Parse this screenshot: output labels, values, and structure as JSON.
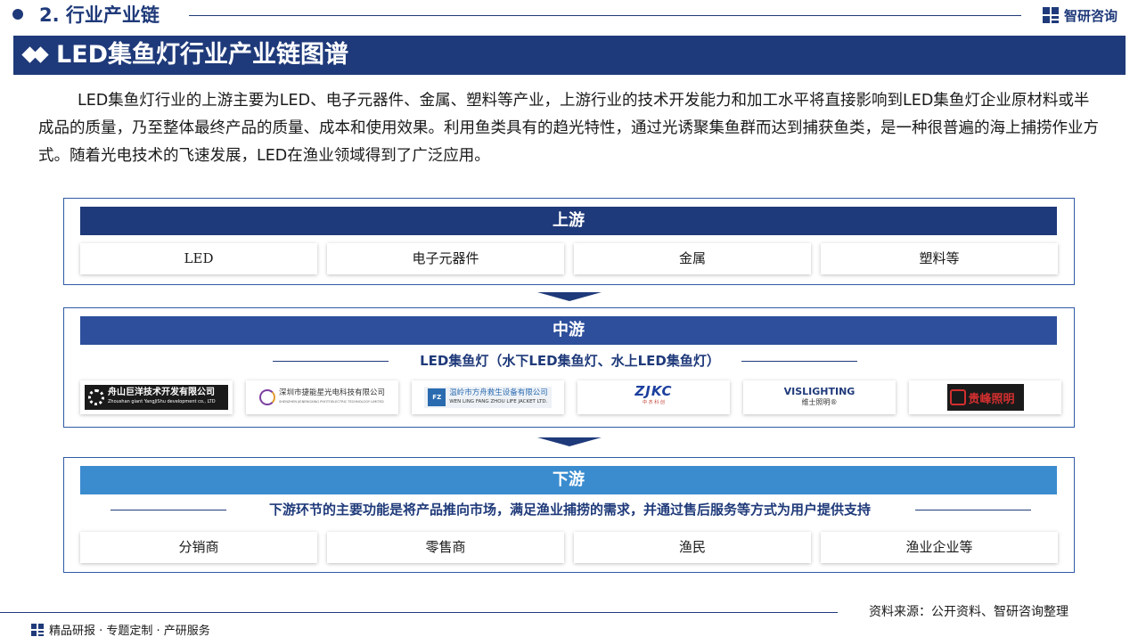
{
  "header": {
    "section_title": "2. 行业产业链",
    "brand": "智研咨询"
  },
  "banner": {
    "title": "LED集鱼灯行业产业链图谱"
  },
  "intro": "LED集鱼灯行业的上游主要为LED、电子元器件、金属、塑料等产业，上游行业的技术开发能力和加工水平将直接影响到LED集鱼灯企业原材料或半成品的质量，乃至整体最终产品的质量、成本和使用效果。利用鱼类具有的趋光特性，通过光诱聚集鱼群而达到捕获鱼类，是一种很普遍的海上捕捞作业方式。随着光电技术的飞速发展，LED在渔业领域得到了广泛应用。",
  "upstream": {
    "title": "上游",
    "items": [
      "LED",
      "电子元器件",
      "金属",
      "塑料等"
    ]
  },
  "midstream": {
    "title": "中游",
    "subtitle": "LED集鱼灯（水下LED集鱼灯、水上LED集鱼灯）",
    "logos": [
      {
        "name": "舟山巨洋技术开发有限公司",
        "en": "Zhoushan giant YangJiShu development co., LTD"
      },
      {
        "name": "深圳市捷能星光电科技有限公司",
        "en": "SHENZHEN JIENENGXING PHOTOELECTRIC TECHNOLOGY LIMITED"
      },
      {
        "name": "温岭市方舟救生设备有限公司",
        "en": "WEN LING FANG ZHOU LIFE JACKET LTD."
      },
      {
        "name": "ZJKC",
        "en": "中 杰 科 创"
      },
      {
        "name": "VISLIGHTING",
        "en": "维士照明®"
      },
      {
        "name": "贵峰照明",
        "en": ""
      }
    ]
  },
  "downstream": {
    "title": "下游",
    "subtitle": "下游环节的主要功能是将产品推向市场，满足渔业捕捞的需求，并通过售后服务等方式为用户提供支持",
    "items": [
      "分销商",
      "零售商",
      "渔民",
      "渔业企业等"
    ]
  },
  "footer": {
    "source": "资料来源：公开资料、智研咨询整理",
    "tagline": "精品研报 · 专题定制 · 产研服务"
  },
  "colors": {
    "primary": "#1f3a7a",
    "mid": "#2e4f9c",
    "light": "#3a8ccf"
  }
}
